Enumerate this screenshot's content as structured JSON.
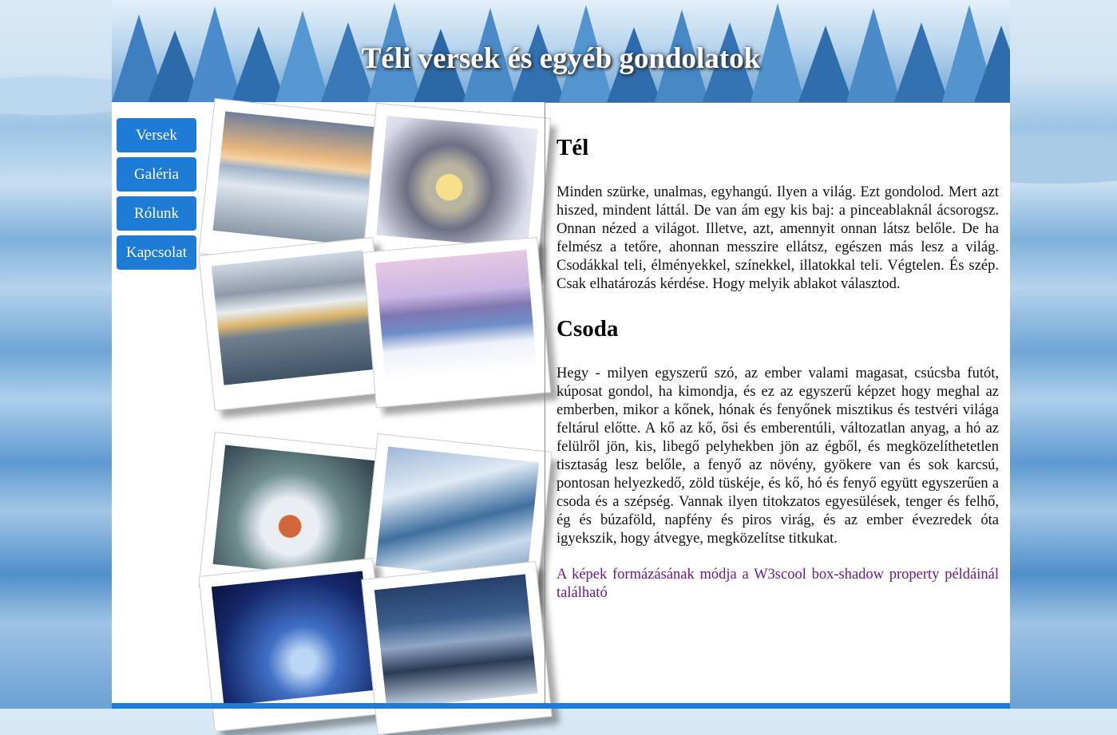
{
  "header": {
    "title": "Téli versek és egyéb gondolatok"
  },
  "nav": {
    "items": [
      "Versek",
      "Galéria",
      "Rólunk",
      "Kapcsolat"
    ]
  },
  "gallery": {
    "photos": [
      {
        "name": "winter-road-photo"
      },
      {
        "name": "lantern-snow-photo"
      },
      {
        "name": "mountain-village-lake-photo"
      },
      {
        "name": "castle-frozen-lake-photo"
      },
      {
        "name": "girl-snow-throw-photo"
      },
      {
        "name": "frozen-river-photo"
      },
      {
        "name": "blue-forest-path-photo"
      },
      {
        "name": "people-winter-valley-photo"
      }
    ]
  },
  "content": {
    "heading1": "Tél",
    "para1": "Minden szürke, unalmas, egyhangú. Ilyen a világ. Ezt gondolod. Mert azt hiszed, mindent láttál. De van ám egy kis baj: a pinceablaknál ácsorogsz. Onnan nézed a világot. Illetve, azt, amennyit onnan látsz belőle. De ha felmész a tetőre, ahonnan messzire ellátsz, egészen más lesz a világ. Csodákkal teli, élményekkel, színekkel, illatokkal teli. Végtelen. És szép. Csak elhatározás kérdése. Hogy melyik ablakot választod.",
    "heading2": "Csoda",
    "para2": "Hegy - milyen egyszerű szó, az ember valami magasat, csúcsba futót, kúposat gondol, ha kimondja, és ez az egyszerű képzet hogy meghal az emberben, mikor a kőnek, hónak és fenyőnek misztikus és testvéri világa feltárul előtte. A kő az kő, ősi és emberentúli, változatlan anyag, a hó az felülről jön, kis, libegő pelyhekben jön az égből, és megközelíthetetlen tisztaság lesz belőle, a fenyő az növény, gyökere van és sok karcsú, pontosan helyezkedő, zöld tüskéje, és kő, hó és fenyő együtt egyszerűen a csoda és a szépség. Vannak ilyen titokzatos egyesülések, tenger és felhő, ég és búzaföld, napfény és piros virág, és az ember évezredek óta igyekszik, hogy átvegye, megközelítse titkukat.",
    "link": "A képek formázásának módja a W3scool box-shadow property példáinál található"
  },
  "colors": {
    "accent": "#1e7bd6",
    "link": "#6a1a8a"
  }
}
